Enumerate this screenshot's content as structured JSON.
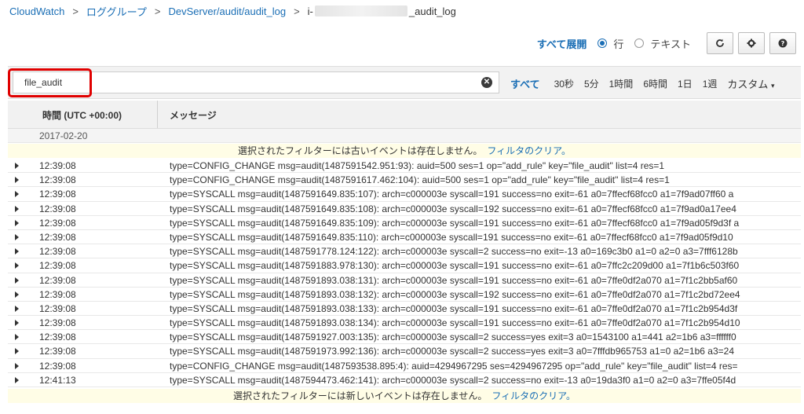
{
  "breadcrumb": {
    "items": [
      "CloudWatch",
      "ロググループ",
      "DevServer/audit/audit_log"
    ],
    "separator": ">",
    "current_prefix": "i-",
    "current_suffix": "_audit_log"
  },
  "viewbar": {
    "expand_all": "すべて展開",
    "radio_row": "行",
    "radio_text": "テキスト",
    "selected": "行"
  },
  "filter": {
    "value": "file_audit",
    "time_ranges": [
      "すべて",
      "30秒",
      "5分",
      "1時間",
      "6時間",
      "1日",
      "1週"
    ],
    "custom": "カスタム",
    "active": "すべて"
  },
  "table": {
    "col_time": "時間 (UTC +00:00)",
    "col_message": "メッセージ",
    "date": "2017-02-20"
  },
  "notice_top": {
    "text": "選択されたフィルターには古いイベントは存在しません。",
    "link": "フィルタのクリア。"
  },
  "notice_bottom": {
    "text": "選択されたフィルターには新しいイベントは存在しません。",
    "link": "フィルタのクリア。"
  },
  "rows": [
    {
      "time": "12:39:08",
      "message": "type=CONFIG_CHANGE msg=audit(1487591542.951:93): auid=500 ses=1 op=\"add_rule\" key=\"file_audit\" list=4 res=1"
    },
    {
      "time": "12:39:08",
      "message": "type=CONFIG_CHANGE msg=audit(1487591617.462:104): auid=500 ses=1 op=\"add_rule\" key=\"file_audit\" list=4 res=1"
    },
    {
      "time": "12:39:08",
      "message": "type=SYSCALL msg=audit(1487591649.835:107): arch=c000003e syscall=191 success=no exit=-61 a0=7ffecf68fcc0 a1=7f9ad07ff60 a"
    },
    {
      "time": "12:39:08",
      "message": "type=SYSCALL msg=audit(1487591649.835:108): arch=c000003e syscall=192 success=no exit=-61 a0=7ffecf68fcc0 a1=7f9ad0a17ee4"
    },
    {
      "time": "12:39:08",
      "message": "type=SYSCALL msg=audit(1487591649.835:109): arch=c000003e syscall=191 success=no exit=-61 a0=7ffecf68fcc0 a1=7f9ad05f9d3f a"
    },
    {
      "time": "12:39:08",
      "message": "type=SYSCALL msg=audit(1487591649.835:110): arch=c000003e syscall=191 success=no exit=-61 a0=7ffecf68fcc0 a1=7f9ad05f9d10"
    },
    {
      "time": "12:39:08",
      "message": "type=SYSCALL msg=audit(1487591778.124:122): arch=c000003e syscall=2 success=no exit=-13 a0=169c3b0 a1=0 a2=0 a3=7fff6128b"
    },
    {
      "time": "12:39:08",
      "message": "type=SYSCALL msg=audit(1487591883.978:130): arch=c000003e syscall=191 success=no exit=-61 a0=7ffc2c209d00 a1=7f1b6c503f60"
    },
    {
      "time": "12:39:08",
      "message": "type=SYSCALL msg=audit(1487591893.038:131): arch=c000003e syscall=191 success=no exit=-61 a0=7ffe0df2a070 a1=7f1c2bb5af60"
    },
    {
      "time": "12:39:08",
      "message": "type=SYSCALL msg=audit(1487591893.038:132): arch=c000003e syscall=192 success=no exit=-61 a0=7ffe0df2a070 a1=7f1c2bd72ee4"
    },
    {
      "time": "12:39:08",
      "message": "type=SYSCALL msg=audit(1487591893.038:133): arch=c000003e syscall=191 success=no exit=-61 a0=7ffe0df2a070 a1=7f1c2b954d3f"
    },
    {
      "time": "12:39:08",
      "message": "type=SYSCALL msg=audit(1487591893.038:134): arch=c000003e syscall=191 success=no exit=-61 a0=7ffe0df2a070 a1=7f1c2b954d10"
    },
    {
      "time": "12:39:08",
      "message": "type=SYSCALL msg=audit(1487591927.003:135): arch=c000003e syscall=2 success=yes exit=3 a0=1543100 a1=441 a2=1b6 a3=ffffff0"
    },
    {
      "time": "12:39:08",
      "message": "type=SYSCALL msg=audit(1487591973.992:136): arch=c000003e syscall=2 success=yes exit=3 a0=7fffdb965753 a1=0 a2=1b6 a3=24"
    },
    {
      "time": "12:39:08",
      "message": "type=CONFIG_CHANGE msg=audit(1487593538.895:4): auid=4294967295 ses=4294967295 op=\"add_rule\" key=\"file_audit\" list=4 res="
    },
    {
      "time": "12:41:13",
      "message": "type=SYSCALL msg=audit(1487594473.462:141): arch=c000003e syscall=2 success=no exit=-13 a0=19da3f0 a1=0 a2=0 a3=7ffe05f4d"
    }
  ],
  "icons": {
    "refresh": "refresh-icon",
    "settings": "gear-icon",
    "help": "help-icon",
    "clear": "clear-filter-icon",
    "expand": "expand-row-icon"
  },
  "colors": {
    "link": "#1a6eb5",
    "highlight": "#e00000",
    "notice_bg": "#fffde6"
  }
}
